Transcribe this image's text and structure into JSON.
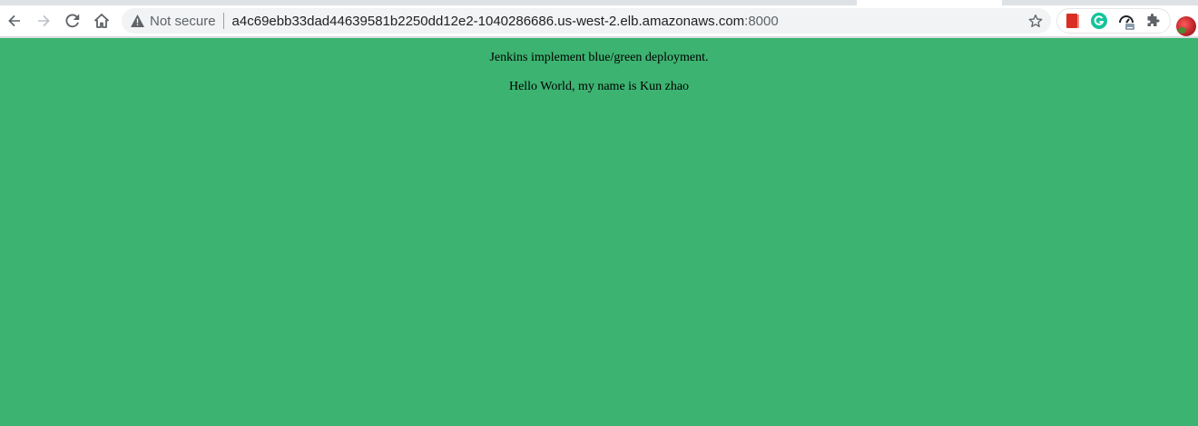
{
  "browser": {
    "security_label": "Not secure",
    "url_host": "a4c69ebb33dad44639581b2250dd12e2-1040286686.us-west-2.elb.amazonaws.com",
    "url_port": ":8000",
    "nav_icons": [
      "back-arrow-icon",
      "forward-arrow-icon",
      "reload-icon",
      "home-icon"
    ],
    "extension_icons": [
      "bookmark-extension-icon",
      "grammarly-extension-icon",
      "speed-extension-icon",
      "puzzle-extensions-icon"
    ],
    "accent_colors": {
      "page_background": "#3cb371",
      "omnibox_background": "#f1f3f4",
      "grammarly": "#15c39a"
    }
  },
  "page": {
    "line1": "Jenkins implement blue/green deployment.",
    "line2": "Hello World, my name is Kun zhao"
  }
}
